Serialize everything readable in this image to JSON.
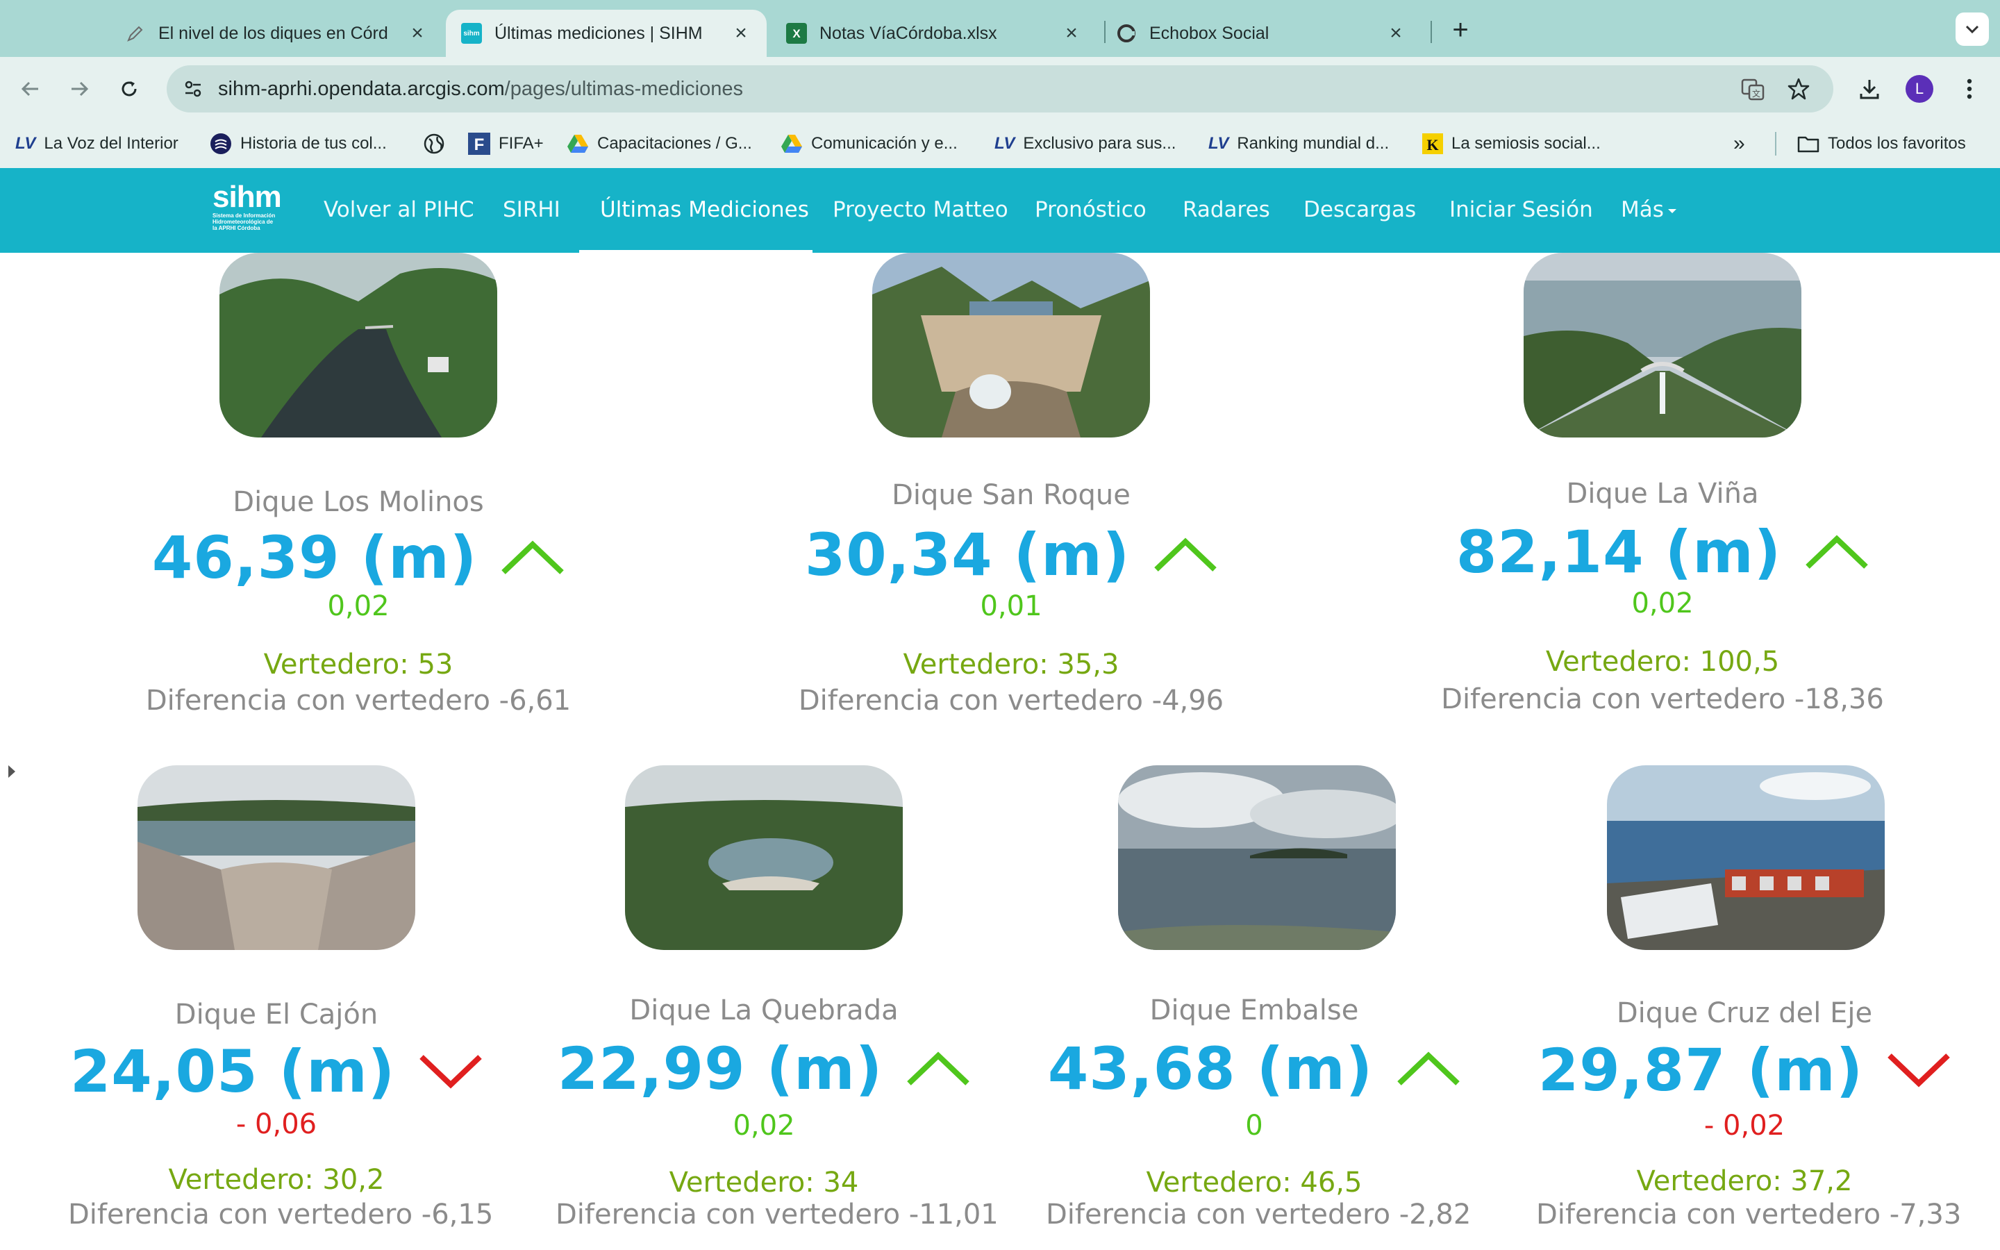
{
  "browser": {
    "tabs": [
      {
        "label": "El nivel de los diques en Córd",
        "icon": "pencil-icon"
      },
      {
        "label": "Últimas mediciones | SIHM",
        "icon": "sihm-favicon"
      },
      {
        "label": "Notas VíaCórdoba.xlsx",
        "icon": "excel-icon"
      },
      {
        "label": "Echobox Social",
        "icon": "echobox-icon"
      }
    ],
    "new_tab": "+",
    "url_host": "sihm-aprhi.opendata.arcgis.com",
    "url_path": "/pages/ultimas-mediciones",
    "profile_initial": "L",
    "bookmarks": [
      {
        "label": "La Voz del Interior",
        "icon": "lv-icon",
        "icon_text": "LV"
      },
      {
        "label": "Historia de tus col...",
        "icon": "history-icon"
      },
      {
        "label": "",
        "icon": "globe-icon"
      },
      {
        "label": "FIFA+",
        "icon": "fifa-icon",
        "icon_text": "F"
      },
      {
        "label": "Capacitaciones / G...",
        "icon": "drive-icon"
      },
      {
        "label": "Comunicación y e...",
        "icon": "drive-icon"
      },
      {
        "label": "Exclusivo para sus...",
        "icon": "lv-icon",
        "icon_text": "LV"
      },
      {
        "label": "Ranking mundial d...",
        "icon": "lv-icon",
        "icon_text": "LV"
      },
      {
        "label": "La semiosis social...",
        "icon": "k-icon",
        "icon_text": "K"
      }
    ],
    "bookmarks_overflow": "»",
    "all_bookmarks": "Todos los favoritos"
  },
  "site": {
    "logo_main": "sihm",
    "logo_sub": "Sistema de Información Hidrometeorológica de la APRHI Córdoba",
    "nav": [
      "Volver al PIHC",
      "SIRHI",
      "Últimas Mediciones",
      "Proyecto Matteo",
      "Pronóstico",
      "Radares",
      "Descargas",
      "Iniciar Sesión",
      "Más"
    ],
    "active_nav": "Últimas Mediciones"
  },
  "colors": {
    "nav_bg": "#16b3c8",
    "level": "#1aa8e0",
    "up": "#4fc61c",
    "down": "#e01f1f",
    "spillway": "#76a812",
    "muted": "#8b8b8b"
  },
  "dams": [
    {
      "name": "Dique Los Molinos",
      "level": "46,39 (m)",
      "trend": "up",
      "delta": "0,02",
      "spillway": "Vertedero: 53",
      "difference": "Diferencia con vertedero -6,61"
    },
    {
      "name": "Dique San Roque",
      "level": "30,34 (m)",
      "trend": "up",
      "delta": "0,01",
      "spillway": "Vertedero: 35,3",
      "difference": "Diferencia con vertedero -4,96"
    },
    {
      "name": "Dique La Viña",
      "level": "82,14 (m)",
      "trend": "up",
      "delta": "0,02",
      "spillway": "Vertedero: 100,5",
      "difference": "Diferencia con vertedero -18,36"
    },
    {
      "name": "Dique El Cajón",
      "level": "24,05 (m)",
      "trend": "down",
      "delta": "- 0,06",
      "spillway": "Vertedero: 30,2",
      "difference": "Diferencia con vertedero -6,15"
    },
    {
      "name": "Dique La Quebrada",
      "level": "22,99 (m)",
      "trend": "up",
      "delta": "0,02",
      "spillway": "Vertedero: 34",
      "difference": "Diferencia con vertedero -11,01"
    },
    {
      "name": "Dique Embalse",
      "level": "43,68 (m)",
      "trend": "up",
      "delta": "0",
      "spillway": "Vertedero: 46,5",
      "difference": "Diferencia con vertedero -2,82"
    },
    {
      "name": "Dique Cruz del Eje",
      "level": "29,87 (m)",
      "trend": "down",
      "delta": "- 0,02",
      "spillway": "Vertedero: 37,2",
      "difference": "Diferencia con vertedero -7,33"
    }
  ]
}
